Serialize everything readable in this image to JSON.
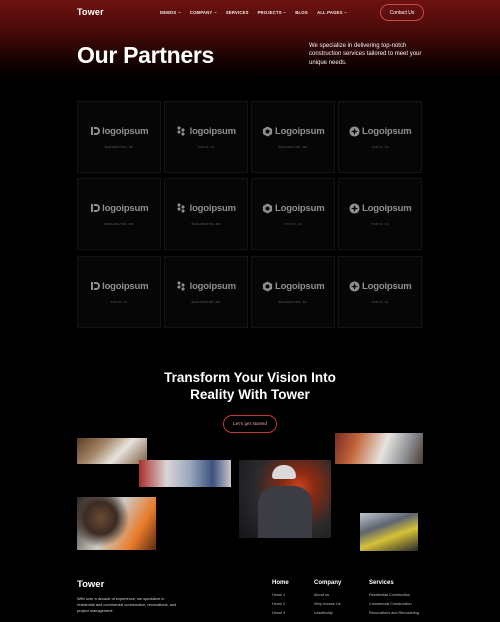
{
  "nav": {
    "brand": "Tower",
    "items": [
      {
        "label": "DEMOS",
        "dropdown": true
      },
      {
        "label": "COMPANY",
        "dropdown": true
      },
      {
        "label": "SERVICES",
        "dropdown": false
      },
      {
        "label": "PROJECTS",
        "dropdown": true
      },
      {
        "label": "BLOG",
        "dropdown": false
      },
      {
        "label": "ALL PAGES",
        "dropdown": true
      }
    ],
    "contact_label": "Contact Us"
  },
  "header": {
    "title": "Our Partners",
    "intro": "We specialize in delivering top-notch construction services tailored to meet your unique needs."
  },
  "partners": [
    {
      "logo": "logoipsum",
      "mark": "d-mark-icon",
      "location": "WASHINGTON, DC"
    },
    {
      "logo": "logoipsum",
      "mark": "diamonds-mark-icon",
      "location": "TOKYO, JA"
    },
    {
      "logo": "Logoipsum",
      "mark": "hexagon-mark-icon",
      "location": "WASHINGTON, MN"
    },
    {
      "logo": "Logoipsum",
      "mark": "circle-star-mark-icon",
      "location": "TOKYO, JA"
    },
    {
      "logo": "logoipsum",
      "mark": "d-mark-icon",
      "location": "WASHINGTON, MN"
    },
    {
      "logo": "logoipsum",
      "mark": "diamonds-mark-icon",
      "location": "WASHINGTON, MN"
    },
    {
      "logo": "Logoipsum",
      "mark": "hexagon-mark-icon",
      "location": "TOKYO, JA"
    },
    {
      "logo": "Logoipsum",
      "mark": "circle-star-mark-icon",
      "location": "TOKYO, JA"
    },
    {
      "logo": "logoipsum",
      "mark": "d-mark-icon",
      "location": "TOKYO, JA"
    },
    {
      "logo": "logoipsum",
      "mark": "diamonds-mark-icon",
      "location": "WASHINGTON, MN"
    },
    {
      "logo": "Logoipsum",
      "mark": "hexagon-mark-icon",
      "location": "WASHINGTON, DC"
    },
    {
      "logo": "Logoipsum",
      "mark": "circle-star-mark-icon",
      "location": "TOKYO, JA"
    }
  ],
  "cta": {
    "title_line1": "Transform Your Vision Into",
    "title_line2": "Reality With Tower",
    "button": "Let's get started"
  },
  "footer": {
    "brand": "Tower",
    "description": "With over a decade of experience, we specialize in residential and commercial construction, renovations, and project management.",
    "columns": [
      {
        "title": "Home",
        "links": [
          "Home 1",
          "Home 2",
          "Home 3"
        ]
      },
      {
        "title": "Company",
        "links": [
          "About us",
          "Why choose Us",
          "Leadership"
        ]
      },
      {
        "title": "Services",
        "links": [
          "Residential Construction",
          "Commercial Construction",
          "Renovations and Remodeling"
        ]
      }
    ]
  },
  "colors": {
    "accent": "#c74a46",
    "hero_red": "#6e1210",
    "background": "#000000"
  }
}
